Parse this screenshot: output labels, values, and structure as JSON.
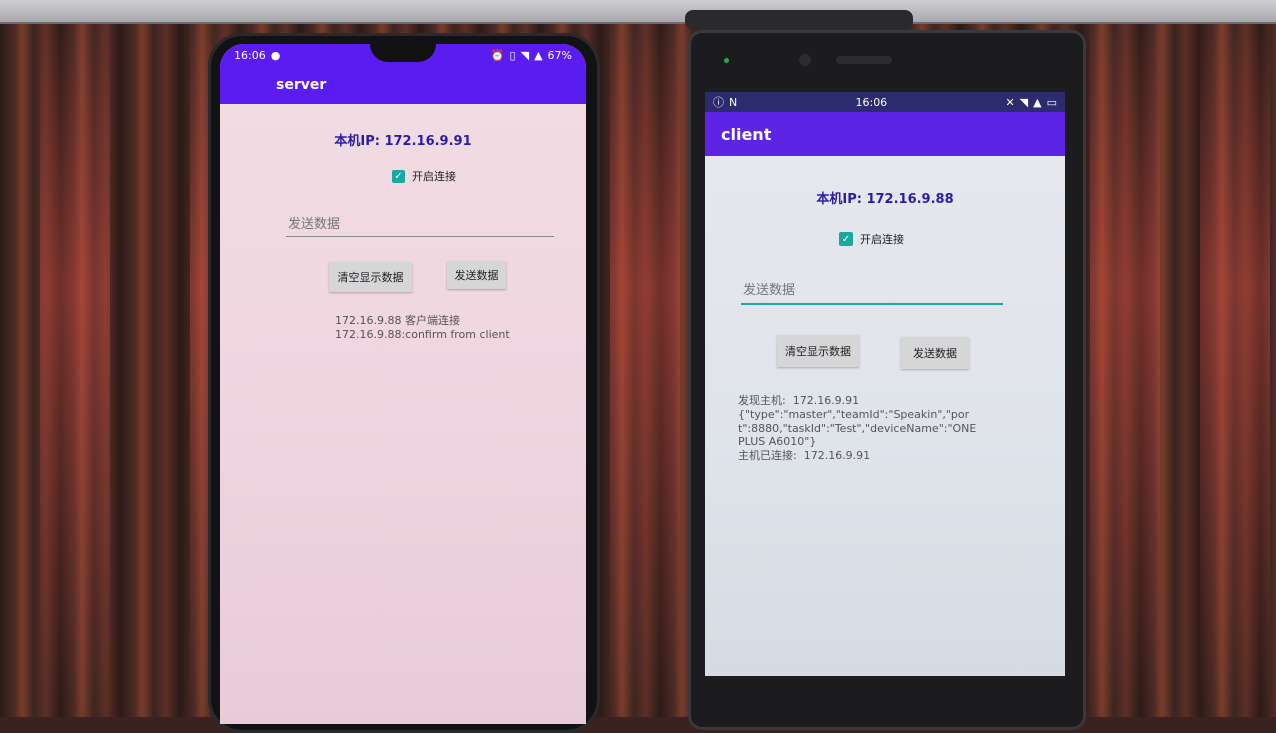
{
  "server": {
    "status_bar": {
      "time": "16:06",
      "battery": "67%"
    },
    "title": "server",
    "local_ip": "本机IP: 172.16.9.91",
    "connect_checkbox": {
      "label": "开启连接",
      "checked": true
    },
    "send_input": {
      "placeholder": "发送数据",
      "value": ""
    },
    "clear_button": "清空显示数据",
    "send_button": "发送数据",
    "log": [
      "172.16.9.88 客户端连接",
      "172.16.9.88:confirm from client"
    ]
  },
  "client": {
    "status_bar": {
      "time": "16:06"
    },
    "title": "client",
    "local_ip": "本机IP: 172.16.9.88",
    "connect_checkbox": {
      "label": "开启连接",
      "checked": true
    },
    "send_input": {
      "placeholder": "发送数据",
      "value": ""
    },
    "clear_button": "清空显示数据",
    "send_button": "发送数据",
    "log": [
      "发现主机:  172.16.9.91",
      "{\"type\":\"master\",\"teamId\":\"Speakin\",\"port\":8880,\"taskId\":\"Test\",\"deviceName\":\"ONEPLUS A6010\"}",
      "主机已连接:  172.16.9.91"
    ]
  },
  "colors": {
    "app_bar": "#5a1cf0",
    "ip_text": "#2a1ea8",
    "checkbox": "#1aa9a0"
  }
}
